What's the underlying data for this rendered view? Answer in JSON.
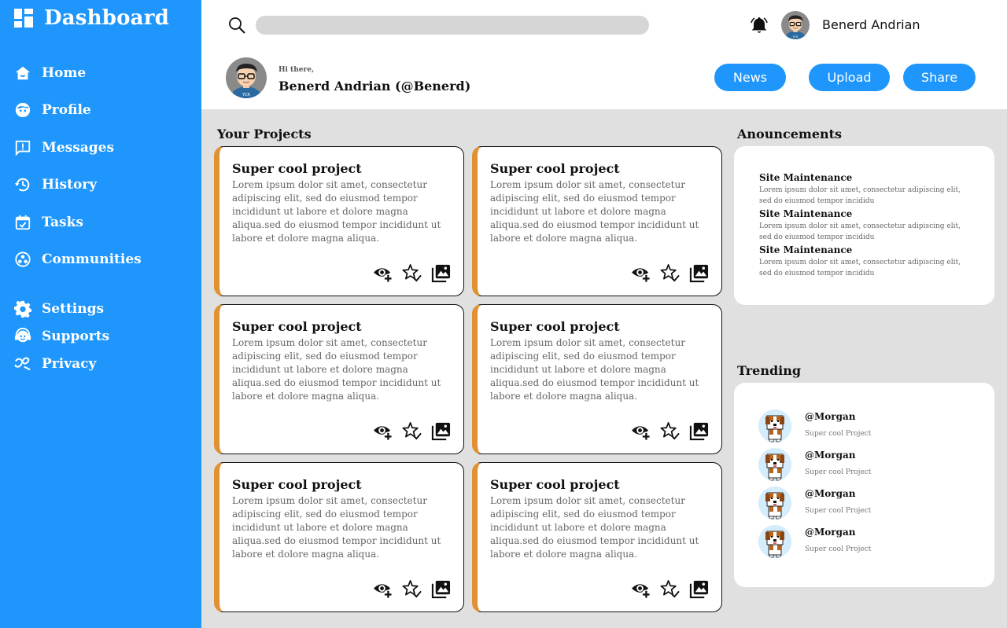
{
  "sidebar": {
    "brand": "Dashboard",
    "items": [
      {
        "label": "Home",
        "icon": "home-icon"
      },
      {
        "label": "Profile",
        "icon": "profile-icon"
      },
      {
        "label": "Messages",
        "icon": "messages-icon"
      },
      {
        "label": "History",
        "icon": "history-icon"
      },
      {
        "label": "Tasks",
        "icon": "tasks-icon"
      },
      {
        "label": "Communities",
        "icon": "communities-icon"
      },
      {
        "label": "Settings",
        "icon": "gear-icon"
      },
      {
        "label": "Supports",
        "icon": "support-icon"
      },
      {
        "label": "Privacy",
        "icon": "privacy-icon"
      }
    ]
  },
  "header": {
    "search_placeholder": "",
    "user_name": "Benerd Andrian",
    "greeting": "Hi there,",
    "full_name": "Benerd Andrian (@Benerd)",
    "buttons": {
      "news": "News",
      "upload": "Upload",
      "share": "Share"
    }
  },
  "projects": {
    "title": "Your Projects",
    "cards": [
      {
        "title": "Super cool project",
        "text": "Lorem ipsum dolor sit amet, consectetur adipiscing elit, sed do eiusmod tempor incididunt ut labore et dolore magna aliqua.sed do eiusmod tempor incididunt ut labore et dolore magna aliqua."
      },
      {
        "title": "Super cool project",
        "text": "Lorem ipsum dolor sit amet, consectetur adipiscing elit, sed do eiusmod tempor incididunt ut labore et dolore magna aliqua.sed do eiusmod tempor incididunt ut labore et dolore magna aliqua."
      },
      {
        "title": "Super cool project",
        "text": "Lorem ipsum dolor sit amet, consectetur adipiscing elit, sed do eiusmod tempor incididunt ut labore et dolore magna aliqua.sed do eiusmod tempor incididunt ut labore et dolore magna aliqua."
      },
      {
        "title": "Super cool project",
        "text": "Lorem ipsum dolor sit amet, consectetur adipiscing elit, sed do eiusmod tempor incididunt ut labore et dolore magna aliqua.sed do eiusmod tempor incididunt ut labore et dolore magna aliqua."
      },
      {
        "title": "Super cool project",
        "text": "Lorem ipsum dolor sit amet, consectetur adipiscing elit, sed do eiusmod tempor incididunt ut labore et dolore magna aliqua.sed do eiusmod tempor incididunt ut labore et dolore magna aliqua."
      },
      {
        "title": "Super cool project",
        "text": "Lorem ipsum dolor sit amet, consectetur adipiscing elit, sed do eiusmod tempor incididunt ut labore et dolore magna aliqua.sed do eiusmod tempor incididunt ut labore et dolore magna aliqua."
      }
    ]
  },
  "announcements": {
    "title": "Anouncements",
    "items": [
      {
        "title": "Site Maintenance",
        "text": "Lorem ipsum dolor sit amet, consectetur adipiscing elit, sed do eiusmod tempor incididu"
      },
      {
        "title": "Site Maintenance",
        "text": "Lorem ipsum dolor sit amet, consectetur adipiscing elit, sed do eiusmod tempor incididu"
      },
      {
        "title": "Site Maintenance",
        "text": "Lorem ipsum dolor sit amet, consectetur adipiscing elit, sed do eiusmod tempor incididu"
      }
    ]
  },
  "trending": {
    "title": "Trending",
    "items": [
      {
        "handle": "@Morgan",
        "project": "Super cool Project"
      },
      {
        "handle": "@Morgan",
        "project": "Super cool Project"
      },
      {
        "handle": "@Morgan",
        "project": "Super cool Project"
      },
      {
        "handle": "@Morgan",
        "project": "Super cool Project"
      }
    ]
  },
  "colors": {
    "accent": "#1e96fc",
    "card_stripe": "#e09132",
    "background": "#e0e0e0"
  }
}
